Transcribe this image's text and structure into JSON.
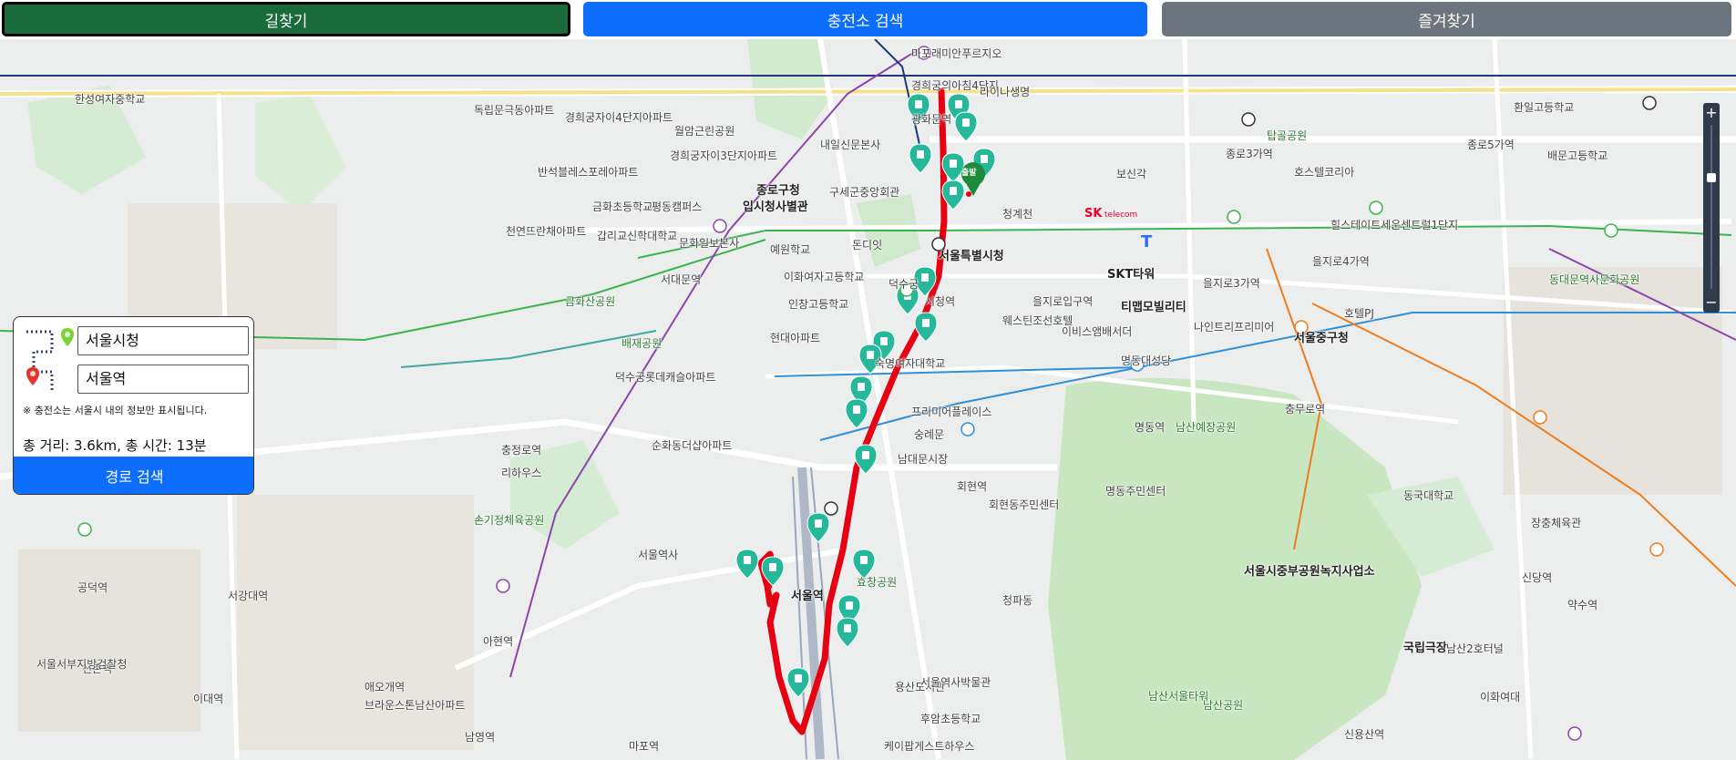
{
  "tabs": {
    "route": "길찾기",
    "charger": "충전소 검색",
    "favorites": "즐겨찾기"
  },
  "panel": {
    "origin_value": "서울시청",
    "destination_value": "서울역",
    "note": "※ 충전소는 서울시 내의 정보만 표시됩니다.",
    "summary": "총 거리: 3.6km, 총 시간: 13분",
    "search_button": "경로 검색"
  },
  "map": {
    "start_badge": "출발",
    "zoom_in": "+",
    "zoom_out": "−",
    "colors": {
      "route": "#e60012",
      "marker": "#26b89a",
      "tab_route": "#1a6b3c",
      "tab_charger": "#0d6efd",
      "tab_favorites": "#6c757d"
    },
    "labels": [
      "한성여자중학교",
      "독립문극동아파트",
      "경희궁자이4단지아파트",
      "월암근린공원",
      "경희궁의아침4단지",
      "라이나생명",
      "경희궁자이3단지아파트",
      "반석블레스포레아파트",
      "광화문역",
      "내일신문본사",
      "종로구청",
      "입시청사별관",
      "구세군중앙회관",
      "금화초등학교",
      "평동캠퍼스",
      "갑리교신학대학교",
      "천연뜨란채아파트",
      "문화일보본사",
      "예원학교",
      "돈디잇",
      "서울특별시청",
      "서대문역",
      "이화여자고등학교",
      "덕수궁",
      "시청역",
      "금화산공원",
      "인창고등학교",
      "배재공원",
      "현대아파트",
      "덕수궁롯데캐슬아파트",
      "충정로역",
      "리하우스",
      "순화동더샵아파트",
      "웨스틴조선호텔",
      "프리미어플레이스",
      "을지로입구역",
      "이비스앰배서더",
      "SKT타워",
      "티맵모빌리티",
      "명동대성당",
      "을지로3가역",
      "나인트리프리미어",
      "을지로4가역",
      "호텔PJ",
      "서울중구청",
      "동대문역사문화공원",
      "종로3가역",
      "종로5가역",
      "보신각",
      "탑골공원",
      "호스텔코리아",
      "힐스테이트세운센트럴1단지",
      "청계천",
      "서울역",
      "회현역",
      "숭례문",
      "남대문시장",
      "명동역",
      "남산예장공원",
      "명동주민센터",
      "회현동주민센터",
      "남산서울타워",
      "남산공원",
      "서울시중부공원녹지사업소",
      "국립극장",
      "약수역",
      "신당역",
      "충무로역",
      "동국대학교",
      "장충체육관",
      "후암초등학교",
      "숙명여자대학교",
      "서울역사",
      "손기정체육공원",
      "아현역",
      "애오개역",
      "공덕역",
      "신촌역",
      "서강대역",
      "이대역",
      "마포역",
      "청파동",
      "효창공원",
      "용산도서관",
      "서울역사박물관",
      "케이팝게스트하우스",
      "브라운스톤남산아파트",
      "남영역",
      "신용산역",
      "마포래미안푸르지오",
      "서울서부지방검찰청",
      "남산2호터널",
      "이화여대",
      "환일고등학교",
      "배문고등학교"
    ]
  }
}
